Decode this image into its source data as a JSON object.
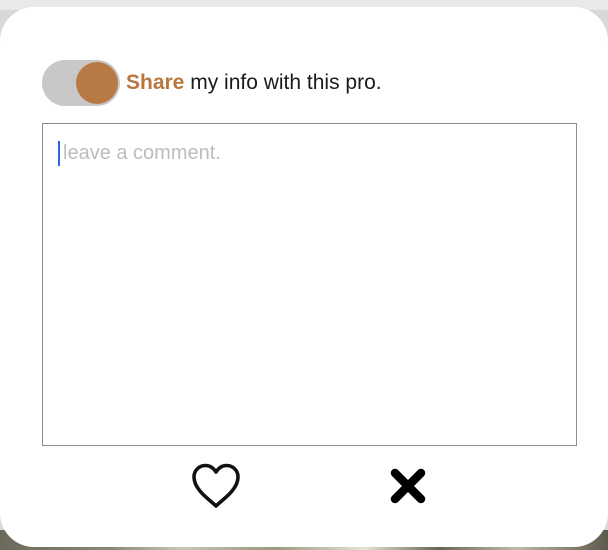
{
  "share": {
    "toggle_on": true,
    "emphasis": "Share",
    "rest": " my info with this pro."
  },
  "comment": {
    "placeholder": "leave a comment.",
    "value": ""
  },
  "actions": {
    "like_icon": "heart-icon",
    "dismiss_icon": "close-icon"
  },
  "colors": {
    "accent": "#b8773f",
    "toggle_track": "#c8c8c8",
    "caret": "#2f62e0"
  }
}
